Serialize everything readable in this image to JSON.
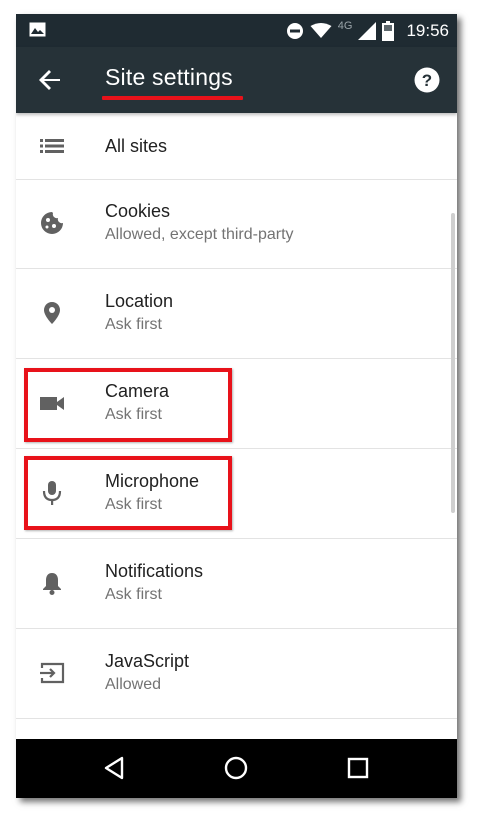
{
  "status_bar": {
    "time": "19:56",
    "network_label": "4G",
    "icons": [
      "image-icon",
      "do-not-disturb-icon",
      "wifi-icon",
      "signal-icon",
      "battery-icon"
    ]
  },
  "app_bar": {
    "title": "Site settings",
    "back_icon": "arrow-back-icon",
    "help_icon": "help-icon"
  },
  "list": {
    "items": [
      {
        "icon": "list-icon",
        "title": "All sites",
        "subtitle": ""
      },
      {
        "icon": "cookie-icon",
        "title": "Cookies",
        "subtitle": "Allowed, except third-party"
      },
      {
        "icon": "location-pin-icon",
        "title": "Location",
        "subtitle": "Ask first"
      },
      {
        "icon": "videocam-icon",
        "title": "Camera",
        "subtitle": "Ask first"
      },
      {
        "icon": "microphone-icon",
        "title": "Microphone",
        "subtitle": "Ask first"
      },
      {
        "icon": "bell-icon",
        "title": "Notifications",
        "subtitle": "Ask first"
      },
      {
        "icon": "javascript-icon",
        "title": "JavaScript",
        "subtitle": "Allowed"
      }
    ]
  },
  "nav_bar": {
    "icons": [
      "back-triangle-icon",
      "home-circle-icon",
      "recents-square-icon"
    ]
  },
  "colors": {
    "status_bar": "#1f2b32",
    "app_bar": "#263238",
    "highlight": "#e8121a",
    "title_text": "#212121",
    "subtitle_text": "#737373"
  }
}
